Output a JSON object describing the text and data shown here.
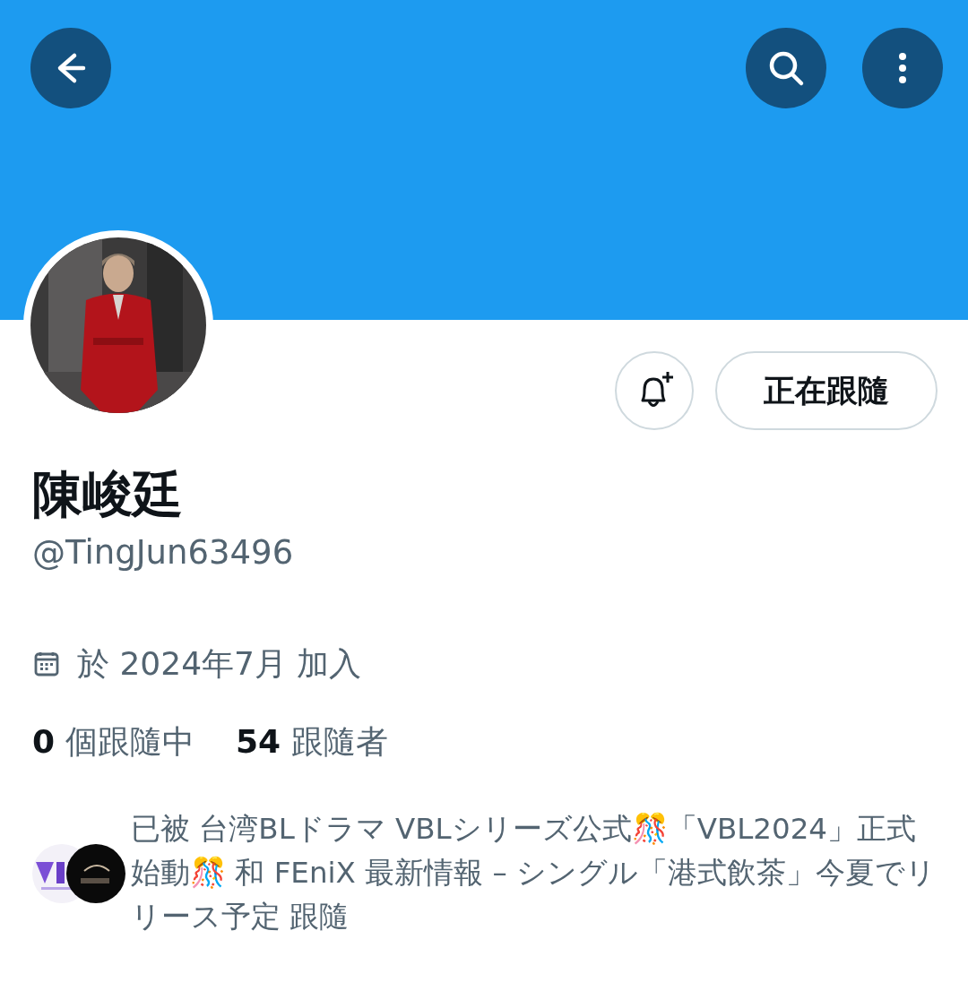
{
  "header": {
    "buttons": [
      {
        "kind": "back"
      },
      {
        "kind": "search"
      },
      {
        "kind": "more"
      }
    ]
  },
  "profile": {
    "notify_button": {
      "kind": "bell-add"
    },
    "follow_button": {
      "label": "正在跟隨"
    },
    "name": "陳峻廷",
    "handle": "@TingJun63496",
    "joined": "於 2024年7月 加入",
    "stats": [
      {
        "count": "0",
        "label": "個跟隨中"
      },
      {
        "count": "54",
        "label": "跟隨者"
      }
    ]
  },
  "followed_by": {
    "text": "已被 台湾BLドラマ VBLシリーズ公式🎊「VBL2024」正式始動🎊 和 FEniX 最新情報 – シングル「港式飲茶」今夏でリリース予定 跟隨"
  }
}
